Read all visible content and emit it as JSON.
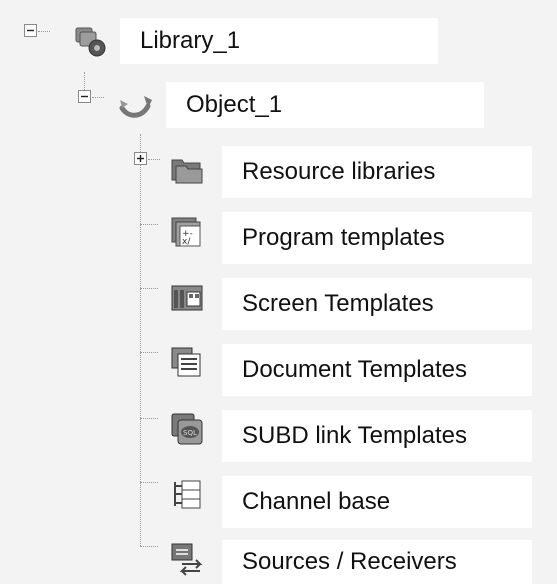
{
  "tree": {
    "root": {
      "label": "Library_1",
      "icon": "library-icon",
      "expanded": true,
      "child": {
        "label": "Object_1",
        "icon": "object-icon",
        "expanded": true,
        "children": [
          {
            "label": "Resource libraries",
            "icon": "resource-libraries-icon",
            "expandable": true,
            "expanded": false
          },
          {
            "label": "Program templates",
            "icon": "program-templates-icon"
          },
          {
            "label": "Screen Templates",
            "icon": "screen-templates-icon"
          },
          {
            "label": "Document Templates",
            "icon": "document-templates-icon"
          },
          {
            "label": "SUBD link Templates",
            "icon": "subd-link-templates-icon"
          },
          {
            "label": "Channel base",
            "icon": "channel-base-icon"
          },
          {
            "label": "Sources / Receivers",
            "icon": "sources-receivers-icon"
          }
        ]
      }
    }
  },
  "colors": {
    "background": "#f3f3f3",
    "label_background": "#ffffff",
    "icon_gray": "#6f6f6f",
    "tree_line": "#9a9a9a"
  }
}
